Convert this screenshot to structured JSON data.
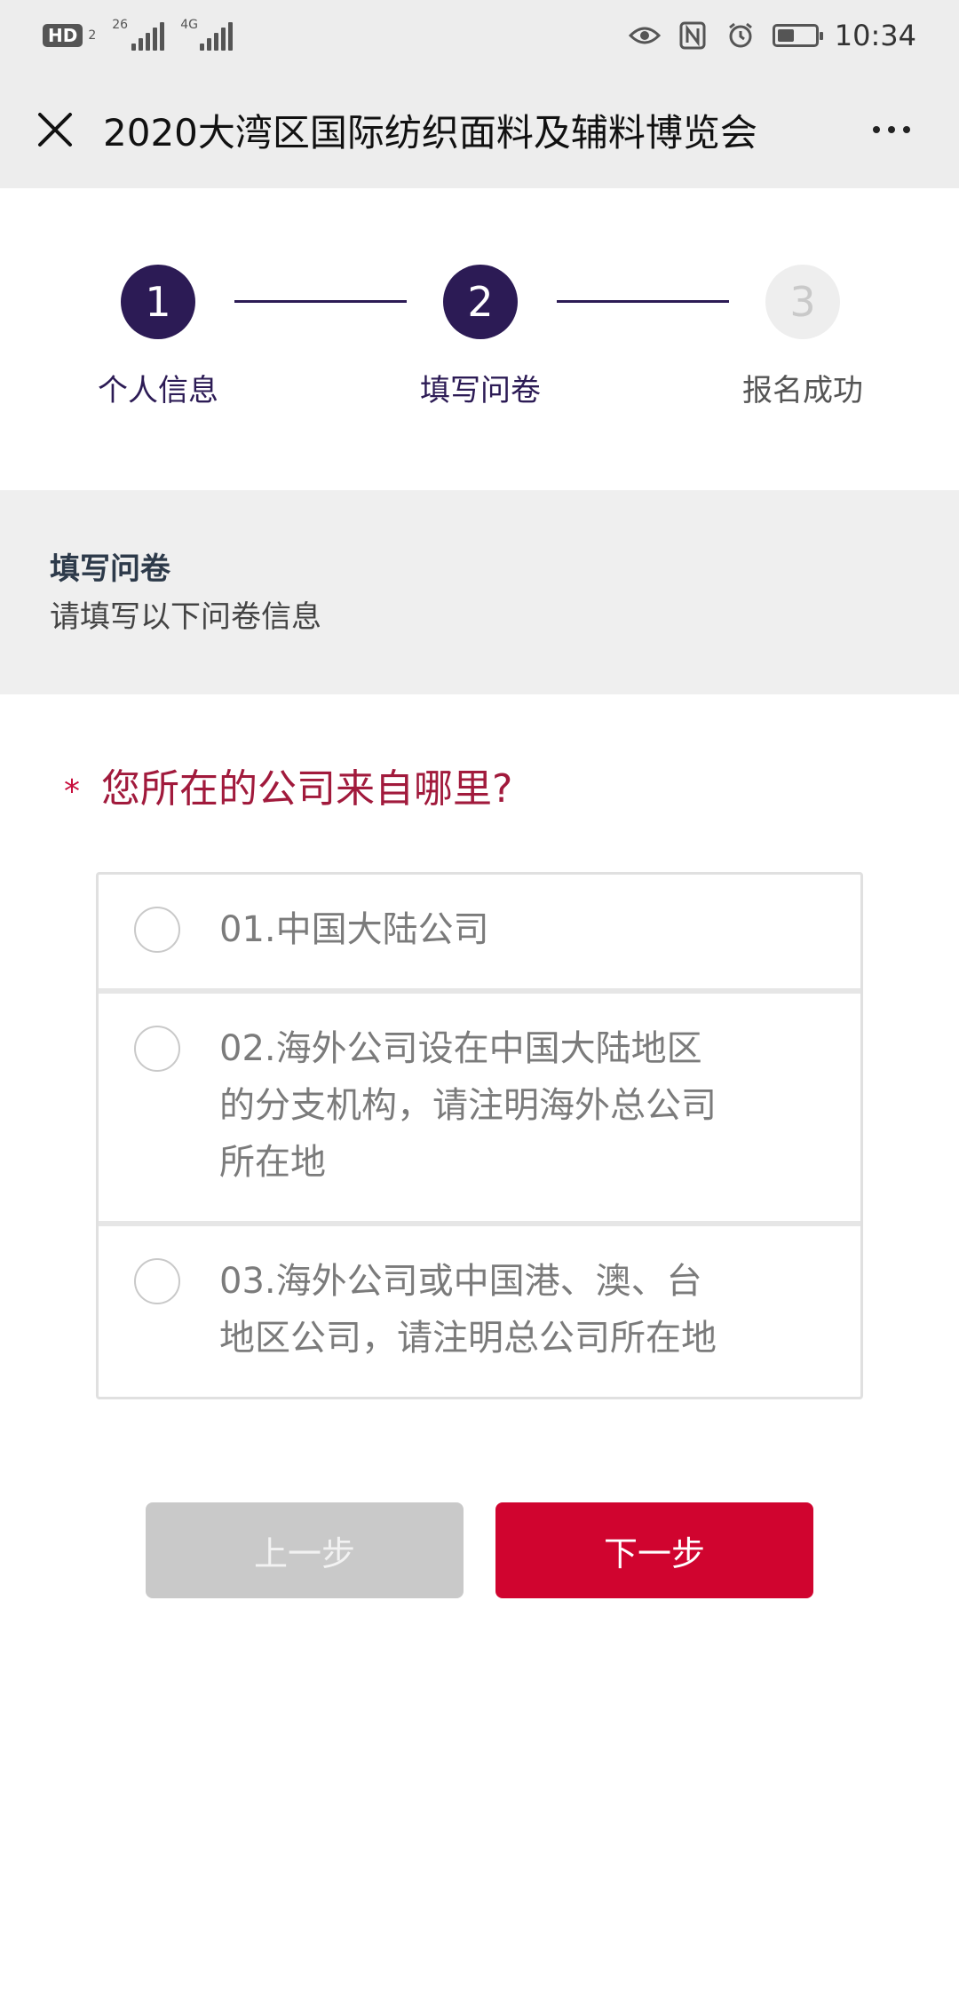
{
  "status_bar": {
    "hd_label": "HD",
    "hd_sub": "2",
    "sim1_label": "26",
    "sim2_label": "4G",
    "time": "10:34",
    "icons": [
      "eye-icon",
      "nfc-icon",
      "alarm-icon",
      "battery-icon"
    ],
    "battery_level_percent": 45
  },
  "nav": {
    "close_icon": "close-icon",
    "title": "2020大湾区国际纺织面料及辅料博览会",
    "more_icon": "more-dots-icon"
  },
  "steps": [
    {
      "number": "1",
      "label": "个人信息",
      "state": "active"
    },
    {
      "number": "2",
      "label": "填写问卷",
      "state": "active"
    },
    {
      "number": "3",
      "label": "报名成功",
      "state": "inactive"
    }
  ],
  "intro": {
    "title": "填写问卷",
    "subtitle": "请填写以下问卷信息"
  },
  "question": {
    "required_mark": "*",
    "text": "您所在的公司来自哪里?",
    "options": [
      {
        "lines": [
          "01.中国大陆公司"
        ]
      },
      {
        "lines": [
          "02.海外公司设在中国大陆地区",
          "的分支机构，请注明海外总公司",
          "所在地"
        ]
      },
      {
        "lines": [
          "03.海外公司或中国港、澳、台",
          "地区公司，请注明总公司所在地"
        ]
      }
    ]
  },
  "buttons": {
    "prev": "上一步",
    "next": "下一步"
  },
  "colors": {
    "accent_purple": "#2c1b55",
    "accent_red": "#d0042f",
    "question_red": "#a11a3c",
    "disabled_gray": "#c9c9c9"
  }
}
